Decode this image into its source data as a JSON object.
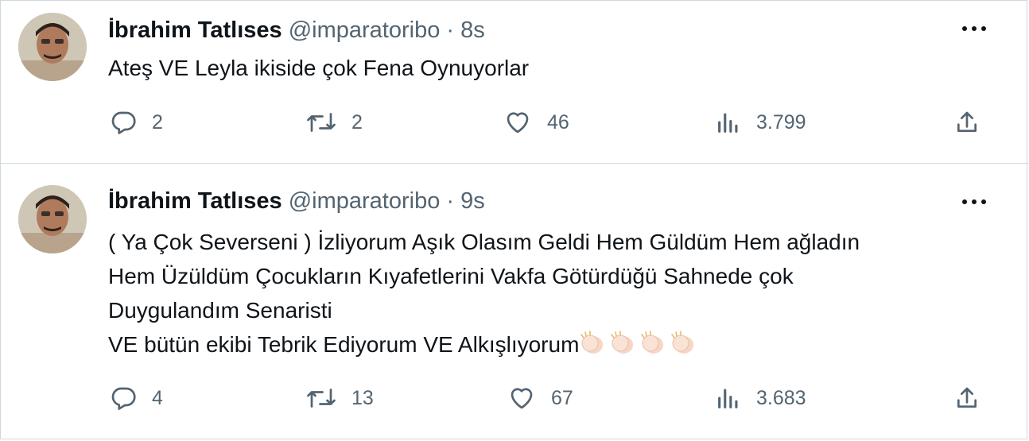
{
  "tweets": [
    {
      "author": {
        "name": "İbrahim Tatlıses",
        "handle": "@imparatoribo",
        "time": "8s",
        "separator": "·"
      },
      "text_lines": [
        "Ateş VE Leyla ikiside çok Fena Oynuyorlar"
      ],
      "stats": {
        "replies": "2",
        "retweets": "2",
        "likes": "46",
        "views": "3.799"
      }
    },
    {
      "author": {
        "name": "İbrahim Tatlıses",
        "handle": "@imparatoribo",
        "time": "9s",
        "separator": "·"
      },
      "text_lines": [
        "( Ya Çok Severseni ) İzliyorum Aşık Olasım Geldi Hem Güldüm Hem ağladın",
        "Hem Üzüldüm Çocukların Kıyafetlerini Vakfa Götürdüğü Sahnede çok",
        "Duygulandım Senaristi",
        "VE bütün ekibi Tebrik Ediyorum VE Alkışlıyorum"
      ],
      "emoji": "clapping-hands x4",
      "stats": {
        "replies": "4",
        "retweets": "13",
        "likes": "67",
        "views": "3.683"
      }
    }
  ],
  "icons": {
    "reply": "reply-icon",
    "retweet": "retweet-icon",
    "like": "like-icon",
    "views": "views-icon",
    "share": "share-icon",
    "more": "more-icon"
  },
  "colors": {
    "text_primary": "#0f1419",
    "text_secondary": "#536471",
    "divider": "#cfd9de"
  }
}
